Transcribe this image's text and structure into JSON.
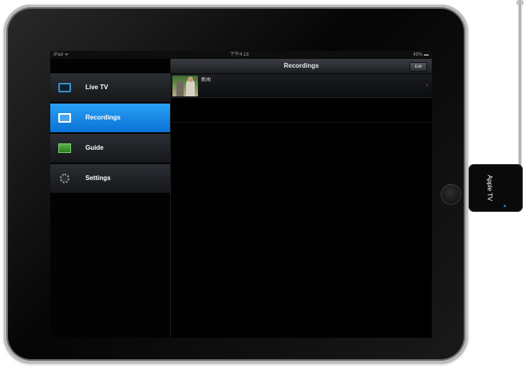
{
  "status_bar": {
    "carrier": "iPad ᯤ",
    "time": "下午4:18",
    "battery": "49% ▬"
  },
  "sidebar": {
    "items": [
      {
        "label": "Live TV",
        "icon": "tv-icon",
        "active": false
      },
      {
        "label": "Recordings",
        "icon": "recordings-icon",
        "active": true
      },
      {
        "label": "Guide",
        "icon": "guide-icon",
        "active": false
      },
      {
        "label": "Settings",
        "icon": "gear-icon",
        "active": false
      }
    ]
  },
  "navbar": {
    "title": "Recordings",
    "edit_label": "Edit"
  },
  "recordings": [
    {
      "title": "新闻",
      "chevron": "›"
    }
  ],
  "device": {
    "label": "Apple TV"
  },
  "colors": {
    "accent": "#1a8ae8",
    "bezel": "#111111",
    "background": "#ffffff"
  }
}
